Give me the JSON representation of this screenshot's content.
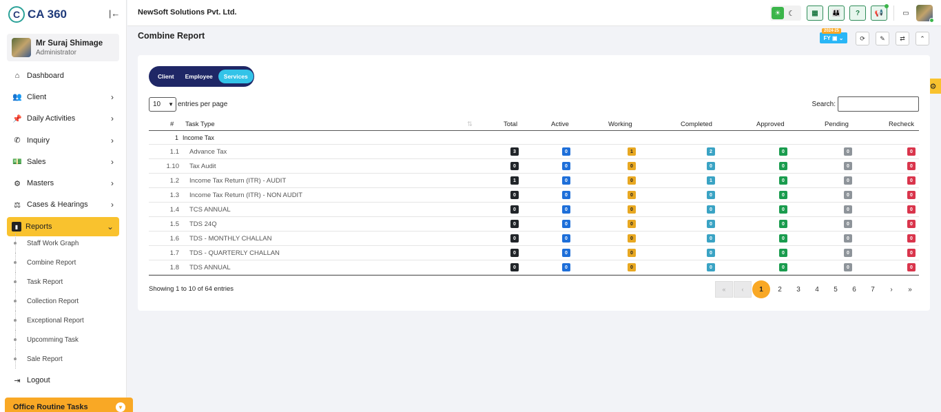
{
  "app": {
    "logo_text": "CA 360",
    "logo_mark": "C"
  },
  "user": {
    "name": "Mr Suraj Shimage",
    "role": "Administrator"
  },
  "sidebar": {
    "items": [
      {
        "label": "Dashboard",
        "icon": "home-icon"
      },
      {
        "label": "Client",
        "icon": "users-icon"
      },
      {
        "label": "Daily Activities",
        "icon": "pin-icon"
      },
      {
        "label": "Inquiry",
        "icon": "phone-icon"
      },
      {
        "label": "Sales",
        "icon": "money-icon"
      },
      {
        "label": "Masters",
        "icon": "gears-icon"
      },
      {
        "label": "Cases & Hearings",
        "icon": "scale-icon"
      },
      {
        "label": "Reports",
        "icon": "file-icon"
      }
    ],
    "sub_items": [
      "Staff Work Graph",
      "Combine Report",
      "Task Report",
      "Collection Report",
      "Exceptional Report",
      "Upcomming Task",
      "Sale Report"
    ],
    "logout": "Logout",
    "office_routine": "Office Routine Tasks"
  },
  "header": {
    "company": "NewSoft Solutions Pvt. Ltd."
  },
  "page": {
    "title": "Combine Report",
    "fy_badge": "2024-25",
    "fy_label": "FY"
  },
  "tabs": [
    "Client",
    "Employee",
    "Services"
  ],
  "table_controls": {
    "entries_value": "10",
    "entries_label": "entries per page",
    "search_label": "Search:"
  },
  "table": {
    "columns": [
      "#",
      "Task Type",
      "Total",
      "Active",
      "Working",
      "Completed",
      "Approved",
      "Pending",
      "Recheck"
    ],
    "group": {
      "num": "1",
      "label": "Income Tax"
    },
    "rows": [
      {
        "num": "1.1",
        "task": "Advance Tax",
        "total": "3",
        "active": "0",
        "working": "1",
        "completed": "2",
        "approved": "0",
        "pending": "0",
        "recheck": "0"
      },
      {
        "num": "1.10",
        "task": "Tax Audit",
        "total": "0",
        "active": "0",
        "working": "0",
        "completed": "0",
        "approved": "0",
        "pending": "0",
        "recheck": "0"
      },
      {
        "num": "1.2",
        "task": "Income Tax Return (ITR) - AUDIT",
        "total": "1",
        "active": "0",
        "working": "0",
        "completed": "1",
        "approved": "0",
        "pending": "0",
        "recheck": "0"
      },
      {
        "num": "1.3",
        "task": "Income Tax Return (ITR) - NON AUDIT",
        "total": "0",
        "active": "0",
        "working": "0",
        "completed": "0",
        "approved": "0",
        "pending": "0",
        "recheck": "0"
      },
      {
        "num": "1.4",
        "task": "TCS ANNUAL",
        "total": "0",
        "active": "0",
        "working": "0",
        "completed": "0",
        "approved": "0",
        "pending": "0",
        "recheck": "0"
      },
      {
        "num": "1.5",
        "task": "TDS 24Q",
        "total": "0",
        "active": "0",
        "working": "0",
        "completed": "0",
        "approved": "0",
        "pending": "0",
        "recheck": "0"
      },
      {
        "num": "1.6",
        "task": "TDS - MONTHLY CHALLAN",
        "total": "0",
        "active": "0",
        "working": "0",
        "completed": "0",
        "approved": "0",
        "pending": "0",
        "recheck": "0"
      },
      {
        "num": "1.7",
        "task": "TDS - QUARTERLY CHALLAN",
        "total": "0",
        "active": "0",
        "working": "0",
        "completed": "0",
        "approved": "0",
        "pending": "0",
        "recheck": "0"
      },
      {
        "num": "1.8",
        "task": "TDS ANNUAL",
        "total": "0",
        "active": "0",
        "working": "0",
        "completed": "0",
        "approved": "0",
        "pending": "0",
        "recheck": "0"
      }
    ]
  },
  "footer": {
    "showing": "Showing 1 to 10 of 64 entries",
    "pager": [
      "«",
      "‹",
      "1",
      "2",
      "3",
      "4",
      "5",
      "6",
      "7",
      "›",
      "»"
    ]
  },
  "colors": {
    "accent_yellow": "#f9c22e",
    "tabs_bg": "#1f2766",
    "tab_active": "#33c3e8"
  }
}
